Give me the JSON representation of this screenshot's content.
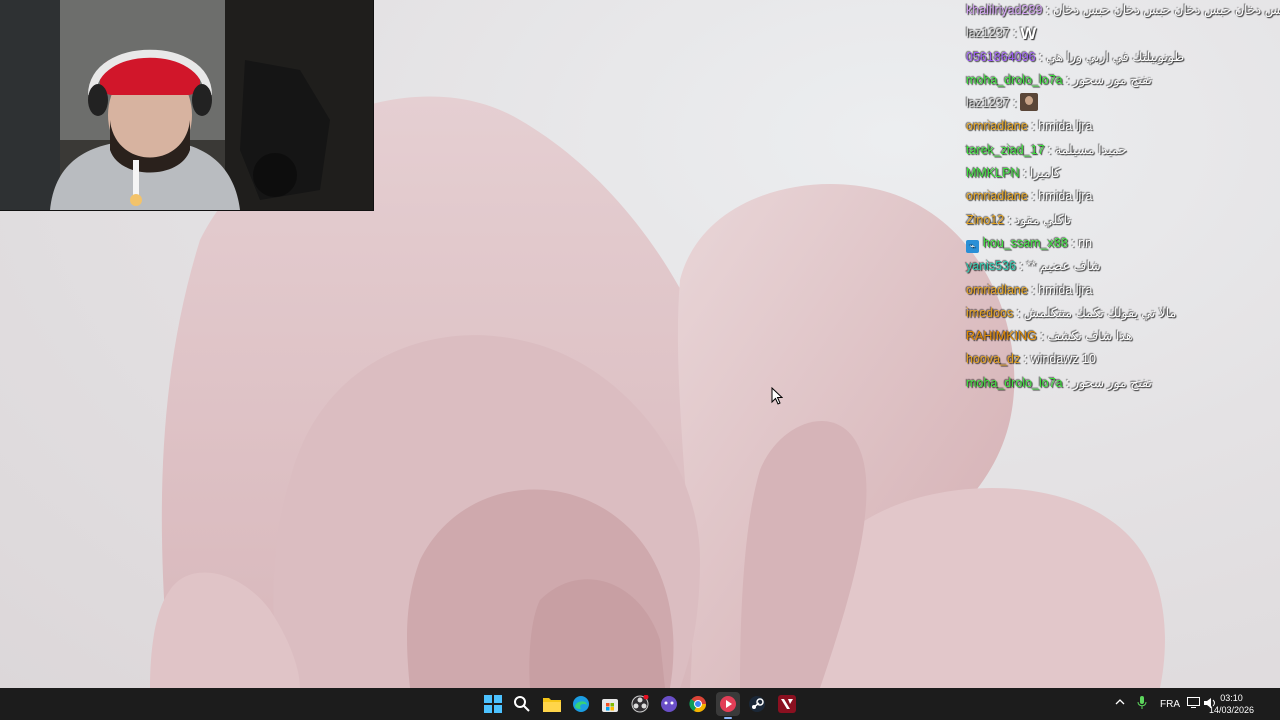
{
  "chat": [
    {
      "user": "khalilriyad289",
      "color": "#d0a0f0",
      "message": "حبس دخان حبس دخان حبس دخان حبس دخان"
    },
    {
      "user": "laz1237",
      "color": "#d9d9d9",
      "message": "",
      "emote": "W"
    },
    {
      "user": "0561864096",
      "color": "#9a5cf0",
      "message": "طونوبيلتك في اربي ورا هي"
    },
    {
      "user": "moha_drolo_lo7a",
      "color": "#3ddc3d",
      "message": "تفتح مور سحور"
    },
    {
      "user": "laz1237",
      "color": "#d9d9d9",
      "message": "",
      "emote": "face"
    },
    {
      "user": "omriadlane",
      "color": "#e0a020",
      "message": "hmida ljra"
    },
    {
      "user": "tarek_ziad_17",
      "color": "#3ddc3d",
      "message": "حميدا مسيلمة"
    },
    {
      "user": "MMKLPN",
      "color": "#3ddc3d",
      "message": "كاميرا"
    },
    {
      "user": "omriadlane",
      "color": "#e0a020",
      "message": "hmida ljra"
    },
    {
      "user": "Zino12",
      "color": "#e0a020",
      "message": "تاكلي مقود"
    },
    {
      "user": "hou_ssam_x88",
      "color": "#3ddc3d",
      "message": "nn",
      "badge": true
    },
    {
      "user": "yanis536",
      "color": "#27c4a8",
      "message": "** شاف عضيم"
    },
    {
      "user": "omriadlane",
      "color": "#e0a020",
      "message": "hmida ljra"
    },
    {
      "user": "imedoos",
      "color": "#e0a020",
      "message": "مالا تي يقولك تكمك متتكلمش"
    },
    {
      "user": "RAHIMKING",
      "color": "#e08a00",
      "message": "هذا شاف نكشف"
    },
    {
      "user": "hoova_dz",
      "color": "#e0a020",
      "message": "windawz 10"
    },
    {
      "user": "moha_drolo_lo7a",
      "color": "#3ddc3d",
      "message": "تفتح مور سحور"
    }
  ],
  "taskbar": {
    "apps": [
      "windows-start-icon",
      "search-icon",
      "file-explorer-icon",
      "edge-icon",
      "microsoft-store-icon",
      "obs-icon",
      "app-purple-icon",
      "chrome-icon",
      "media-player-icon",
      "steam-icon",
      "valorant-icon"
    ],
    "language": "FRA",
    "time": "03:10",
    "date": "14/03/2026"
  }
}
